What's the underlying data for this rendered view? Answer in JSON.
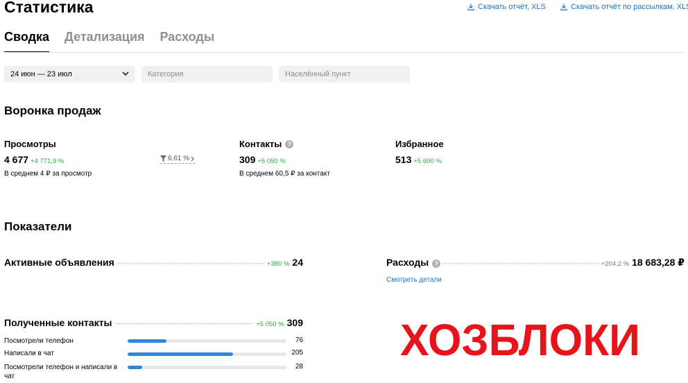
{
  "page": {
    "title": "Статистика"
  },
  "downloads": {
    "report": "Скачать отчёт, XLS",
    "mailing_report": "Скачать отчёт по рассылкам, XLS"
  },
  "tabs": [
    {
      "label": "Сводка",
      "active": true
    },
    {
      "label": "Детализация",
      "active": false
    },
    {
      "label": "Расходы",
      "active": false
    }
  ],
  "filters": {
    "period": "24 июн — 23 июл",
    "category_placeholder": "Категория",
    "city_placeholder": "Населённый пункт"
  },
  "funnel": {
    "title": "Воронка продаж",
    "views": {
      "label": "Просмотры",
      "value": "4 677",
      "delta": "+4 771,9 %",
      "sub": "В среднем 4 ₽ за просмотр"
    },
    "conversion": "6,61 %",
    "contacts": {
      "label": "Контакты",
      "value": "309",
      "delta": "+5 050 %",
      "sub": "В среднем 60,5 ₽ за контакт"
    },
    "favorites": {
      "label": "Избранное",
      "value": "513",
      "delta": "+5 600 %"
    }
  },
  "metrics": {
    "title": "Показатели",
    "active_ads": {
      "label": "Активные объявления",
      "delta": "+380 %",
      "value": "24"
    },
    "expenses": {
      "label": "Расходы",
      "delta": "+204,2 %",
      "value": "18 683,28 ₽",
      "link": "Смотреть детали"
    },
    "received_contacts": {
      "label": "Полученные контакты",
      "delta": "+5 050 %",
      "value": "309"
    },
    "breakdown": [
      {
        "label": "Посмотрели телефон",
        "value": "76",
        "fraction": 0.246
      },
      {
        "label": "Написали в чат",
        "value": "205",
        "fraction": 0.663
      },
      {
        "label": "Посмотрели телефон и написали в чат",
        "value": "28",
        "fraction": 0.091
      }
    ]
  },
  "logo": {
    "text": "ХОЗБЛОКИ",
    "color": "#e8141c"
  },
  "colors": {
    "link": "#1a73c8",
    "positive": "#27a847",
    "bar": "#2b86e0"
  }
}
